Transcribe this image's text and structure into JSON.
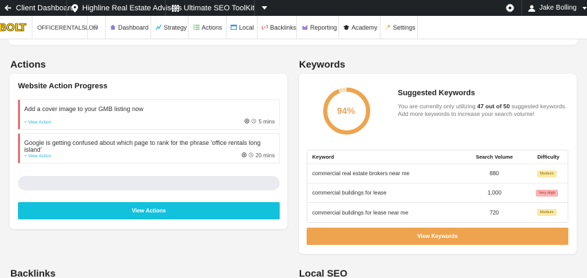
{
  "topbar": {
    "client_dashboard": "Client Dashboard",
    "location": "Highline Real Estate Advisors",
    "toolkit": "Ultimate SEO ToolKit",
    "user": "Jake Bolling"
  },
  "nav": {
    "logo": "BOLT",
    "account": "OFFICERENTALSLON",
    "items": [
      {
        "label": "Dashboard",
        "icon": "home-icon"
      },
      {
        "label": "Strategy",
        "icon": "strategy-icon"
      },
      {
        "label": "Actions",
        "icon": "list-icon"
      },
      {
        "label": "Local",
        "icon": "local-icon"
      },
      {
        "label": "Backlinks",
        "icon": "link-icon"
      },
      {
        "label": "Reporting",
        "icon": "reporting-icon"
      },
      {
        "label": "Academy",
        "icon": "graduation-cap-icon"
      },
      {
        "label": "Settings",
        "icon": "wrench-icon"
      }
    ]
  },
  "actions": {
    "section_title": "Actions",
    "card_title": "Website Action Progress",
    "items": [
      {
        "text": "Add a cover image to your GMB listing now",
        "link": "+ View Action",
        "time": "5 mins"
      },
      {
        "text": "Google is getting confused about which page to rank for the phrase 'office rentals long island'",
        "link": "+ View Action",
        "time": "20 mins"
      }
    ],
    "progress": 0,
    "button": "View Actions"
  },
  "keywords": {
    "section_title": "Keywords",
    "gauge_percent": 94,
    "gauge_label": "94%",
    "suggested_title": "Suggested Keywords",
    "desc_pre": "You are currently only utilizing ",
    "desc_bold": "47 out of 50",
    "desc_post": " suggested keywords. Add more keywords to increase your search volume!",
    "table": {
      "headers": {
        "keyword": "Keyword",
        "volume": "Search Volume",
        "difficulty": "Difficulty"
      },
      "rows": [
        {
          "keyword": "commercial real estate brokers near me",
          "volume": "880",
          "difficulty": "Medium"
        },
        {
          "keyword": "commercial buildings for lease",
          "volume": "1,000",
          "difficulty": "Very High"
        },
        {
          "keyword": "commercial buildings for lease near me",
          "volume": "720",
          "difficulty": "Medium"
        }
      ]
    },
    "button": "View Keywords"
  },
  "bottom": {
    "backlinks_title": "Backlinks",
    "local_seo_title": "Local SEO"
  },
  "colors": {
    "accent_blue": "#12c1dc",
    "accent_orange": "#eea44f",
    "action_border": "#e57373",
    "medium_badge_bg": "#fbe9a6",
    "very_high_badge_bg": "#f8b4b4"
  }
}
